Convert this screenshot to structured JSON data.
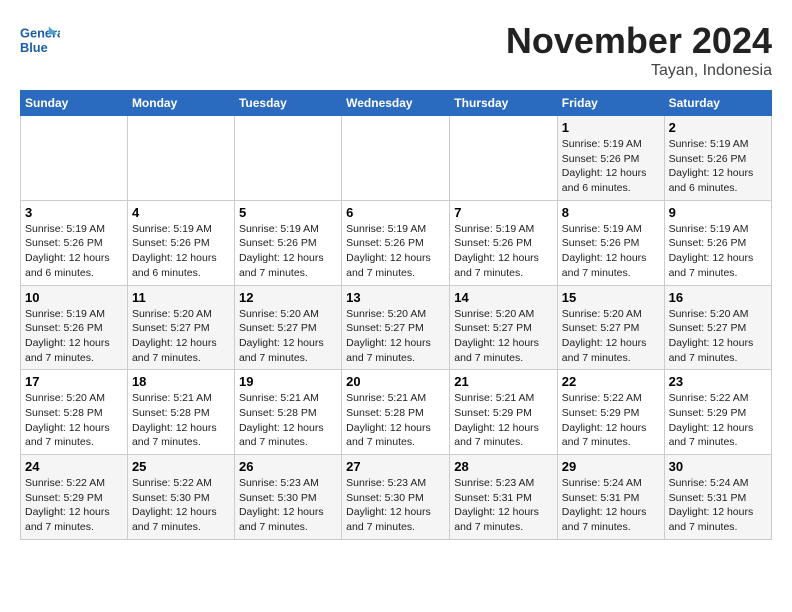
{
  "header": {
    "logo_line1": "General",
    "logo_line2": "Blue",
    "month": "November 2024",
    "location": "Tayan, Indonesia"
  },
  "weekdays": [
    "Sunday",
    "Monday",
    "Tuesday",
    "Wednesday",
    "Thursday",
    "Friday",
    "Saturday"
  ],
  "weeks": [
    [
      {
        "day": "",
        "info": ""
      },
      {
        "day": "",
        "info": ""
      },
      {
        "day": "",
        "info": ""
      },
      {
        "day": "",
        "info": ""
      },
      {
        "day": "",
        "info": ""
      },
      {
        "day": "1",
        "info": "Sunrise: 5:19 AM\nSunset: 5:26 PM\nDaylight: 12 hours and 6 minutes."
      },
      {
        "day": "2",
        "info": "Sunrise: 5:19 AM\nSunset: 5:26 PM\nDaylight: 12 hours and 6 minutes."
      }
    ],
    [
      {
        "day": "3",
        "info": "Sunrise: 5:19 AM\nSunset: 5:26 PM\nDaylight: 12 hours and 6 minutes."
      },
      {
        "day": "4",
        "info": "Sunrise: 5:19 AM\nSunset: 5:26 PM\nDaylight: 12 hours and 6 minutes."
      },
      {
        "day": "5",
        "info": "Sunrise: 5:19 AM\nSunset: 5:26 PM\nDaylight: 12 hours and 7 minutes."
      },
      {
        "day": "6",
        "info": "Sunrise: 5:19 AM\nSunset: 5:26 PM\nDaylight: 12 hours and 7 minutes."
      },
      {
        "day": "7",
        "info": "Sunrise: 5:19 AM\nSunset: 5:26 PM\nDaylight: 12 hours and 7 minutes."
      },
      {
        "day": "8",
        "info": "Sunrise: 5:19 AM\nSunset: 5:26 PM\nDaylight: 12 hours and 7 minutes."
      },
      {
        "day": "9",
        "info": "Sunrise: 5:19 AM\nSunset: 5:26 PM\nDaylight: 12 hours and 7 minutes."
      }
    ],
    [
      {
        "day": "10",
        "info": "Sunrise: 5:19 AM\nSunset: 5:26 PM\nDaylight: 12 hours and 7 minutes."
      },
      {
        "day": "11",
        "info": "Sunrise: 5:20 AM\nSunset: 5:27 PM\nDaylight: 12 hours and 7 minutes."
      },
      {
        "day": "12",
        "info": "Sunrise: 5:20 AM\nSunset: 5:27 PM\nDaylight: 12 hours and 7 minutes."
      },
      {
        "day": "13",
        "info": "Sunrise: 5:20 AM\nSunset: 5:27 PM\nDaylight: 12 hours and 7 minutes."
      },
      {
        "day": "14",
        "info": "Sunrise: 5:20 AM\nSunset: 5:27 PM\nDaylight: 12 hours and 7 minutes."
      },
      {
        "day": "15",
        "info": "Sunrise: 5:20 AM\nSunset: 5:27 PM\nDaylight: 12 hours and 7 minutes."
      },
      {
        "day": "16",
        "info": "Sunrise: 5:20 AM\nSunset: 5:27 PM\nDaylight: 12 hours and 7 minutes."
      }
    ],
    [
      {
        "day": "17",
        "info": "Sunrise: 5:20 AM\nSunset: 5:28 PM\nDaylight: 12 hours and 7 minutes."
      },
      {
        "day": "18",
        "info": "Sunrise: 5:21 AM\nSunset: 5:28 PM\nDaylight: 12 hours and 7 minutes."
      },
      {
        "day": "19",
        "info": "Sunrise: 5:21 AM\nSunset: 5:28 PM\nDaylight: 12 hours and 7 minutes."
      },
      {
        "day": "20",
        "info": "Sunrise: 5:21 AM\nSunset: 5:28 PM\nDaylight: 12 hours and 7 minutes."
      },
      {
        "day": "21",
        "info": "Sunrise: 5:21 AM\nSunset: 5:29 PM\nDaylight: 12 hours and 7 minutes."
      },
      {
        "day": "22",
        "info": "Sunrise: 5:22 AM\nSunset: 5:29 PM\nDaylight: 12 hours and 7 minutes."
      },
      {
        "day": "23",
        "info": "Sunrise: 5:22 AM\nSunset: 5:29 PM\nDaylight: 12 hours and 7 minutes."
      }
    ],
    [
      {
        "day": "24",
        "info": "Sunrise: 5:22 AM\nSunset: 5:29 PM\nDaylight: 12 hours and 7 minutes."
      },
      {
        "day": "25",
        "info": "Sunrise: 5:22 AM\nSunset: 5:30 PM\nDaylight: 12 hours and 7 minutes."
      },
      {
        "day": "26",
        "info": "Sunrise: 5:23 AM\nSunset: 5:30 PM\nDaylight: 12 hours and 7 minutes."
      },
      {
        "day": "27",
        "info": "Sunrise: 5:23 AM\nSunset: 5:30 PM\nDaylight: 12 hours and 7 minutes."
      },
      {
        "day": "28",
        "info": "Sunrise: 5:23 AM\nSunset: 5:31 PM\nDaylight: 12 hours and 7 minutes."
      },
      {
        "day": "29",
        "info": "Sunrise: 5:24 AM\nSunset: 5:31 PM\nDaylight: 12 hours and 7 minutes."
      },
      {
        "day": "30",
        "info": "Sunrise: 5:24 AM\nSunset: 5:31 PM\nDaylight: 12 hours and 7 minutes."
      }
    ]
  ]
}
